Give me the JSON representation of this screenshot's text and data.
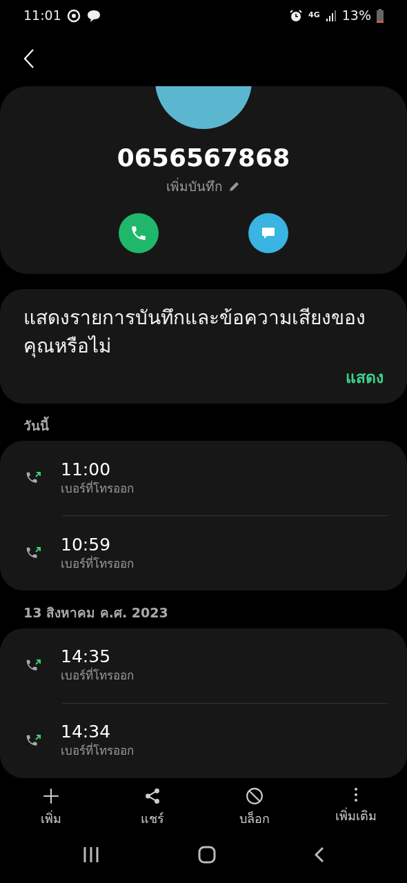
{
  "status_bar": {
    "time": "11:01",
    "network": "4G",
    "battery": "13%"
  },
  "contact": {
    "number": "0656567868",
    "note_action": "เพิ่มบันทึก"
  },
  "prompt": {
    "message": "แสดงรายการบันทึกและข้อความเสียงของคุณหรือไม่",
    "action": "แสดง"
  },
  "call_groups": [
    {
      "date": "วันนี้",
      "calls": [
        {
          "time": "11:00",
          "label": "เบอร์ที่โทรออก",
          "kind": "outgoing"
        },
        {
          "time": "10:59",
          "label": "เบอร์ที่โทรออก",
          "kind": "outgoing"
        }
      ]
    },
    {
      "date": "13 สิงหาคม ค.ศ. 2023",
      "calls": [
        {
          "time": "14:35",
          "label": "เบอร์ที่โทรออก",
          "kind": "outgoing"
        },
        {
          "time": "14:34",
          "label": "เบอร์ที่โทรออก",
          "kind": "outgoing"
        }
      ]
    }
  ],
  "toolbar": [
    {
      "kind": "add",
      "label": "เพิ่ม"
    },
    {
      "kind": "share",
      "label": "แชร์"
    },
    {
      "kind": "block",
      "label": "บล็อก"
    },
    {
      "kind": "more",
      "label": "เพิ่มเติม"
    }
  ]
}
